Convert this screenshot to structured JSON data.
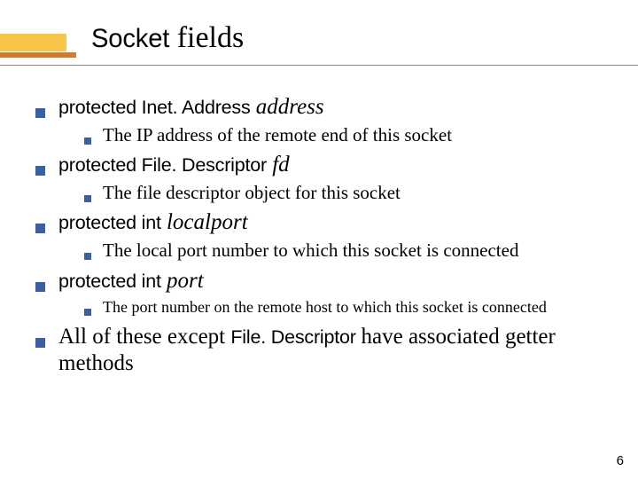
{
  "title": {
    "part1": "Socket",
    "part2": "fields"
  },
  "items": [
    {
      "kw": "protected  ",
      "type": "Inet. Address",
      "var": " address",
      "desc": "The IP address of the remote end of this socket",
      "small": false
    },
    {
      "kw": "protected  ",
      "type": "File. Descriptor",
      "var": " fd",
      "desc": "The file descriptor object for this socket",
      "small": false
    },
    {
      "kw": "protected  int",
      "type": "",
      "var": " localport",
      "desc": "The local port number to which this socket is connected",
      "small": false
    },
    {
      "kw": "protected  int",
      "type": "",
      "var": " port",
      "desc": "The port number on the remote host to which this socket is connected",
      "small": true
    }
  ],
  "summary": {
    "pre": "All of these except ",
    "mid": "File. Descriptor ",
    "post": " have associated getter methods"
  },
  "page": "6"
}
